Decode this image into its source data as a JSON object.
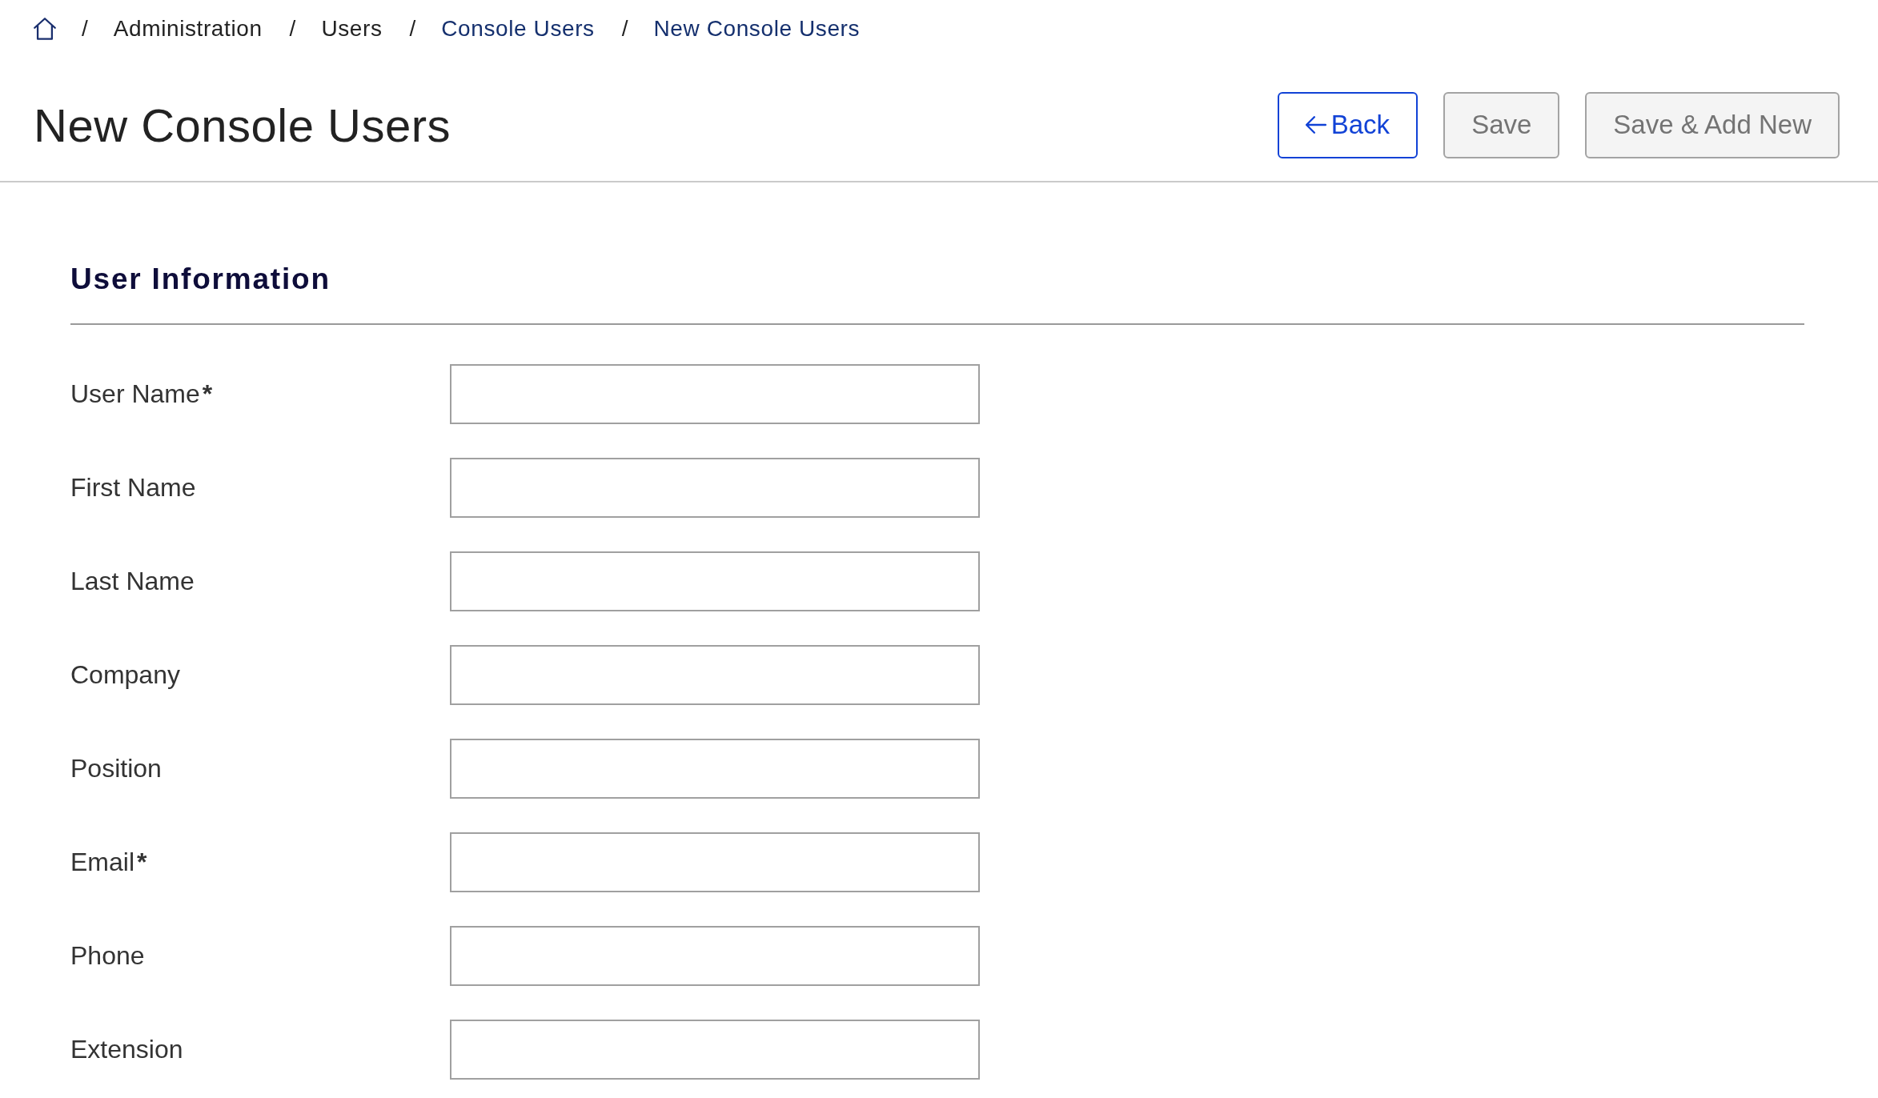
{
  "breadcrumb": {
    "items": [
      {
        "kind": "home"
      },
      {
        "kind": "text",
        "separator": "/",
        "label": "Administration"
      },
      {
        "kind": "text",
        "separator": "/",
        "label": "Users"
      },
      {
        "kind": "link",
        "separator": "/",
        "label": "Console Users"
      },
      {
        "kind": "link",
        "separator": "/",
        "label": "New Console Users"
      }
    ]
  },
  "page": {
    "title": "New Console Users"
  },
  "buttons": [
    {
      "label": "Back",
      "kind": "back",
      "disabled": false
    },
    {
      "label": "Save",
      "kind": "plain",
      "disabled": true
    },
    {
      "label": "Save & Add New",
      "kind": "plain",
      "disabled": true
    }
  ],
  "section": {
    "title": "User Information"
  },
  "fields": [
    {
      "label": "User Name",
      "required_mark": "*"
    },
    {
      "label": "First Name"
    },
    {
      "label": "Last Name"
    },
    {
      "label": "Company"
    },
    {
      "label": "Position"
    },
    {
      "label": "Email",
      "required_mark": "*"
    },
    {
      "label": "Phone"
    },
    {
      "label": "Extension"
    }
  ]
}
